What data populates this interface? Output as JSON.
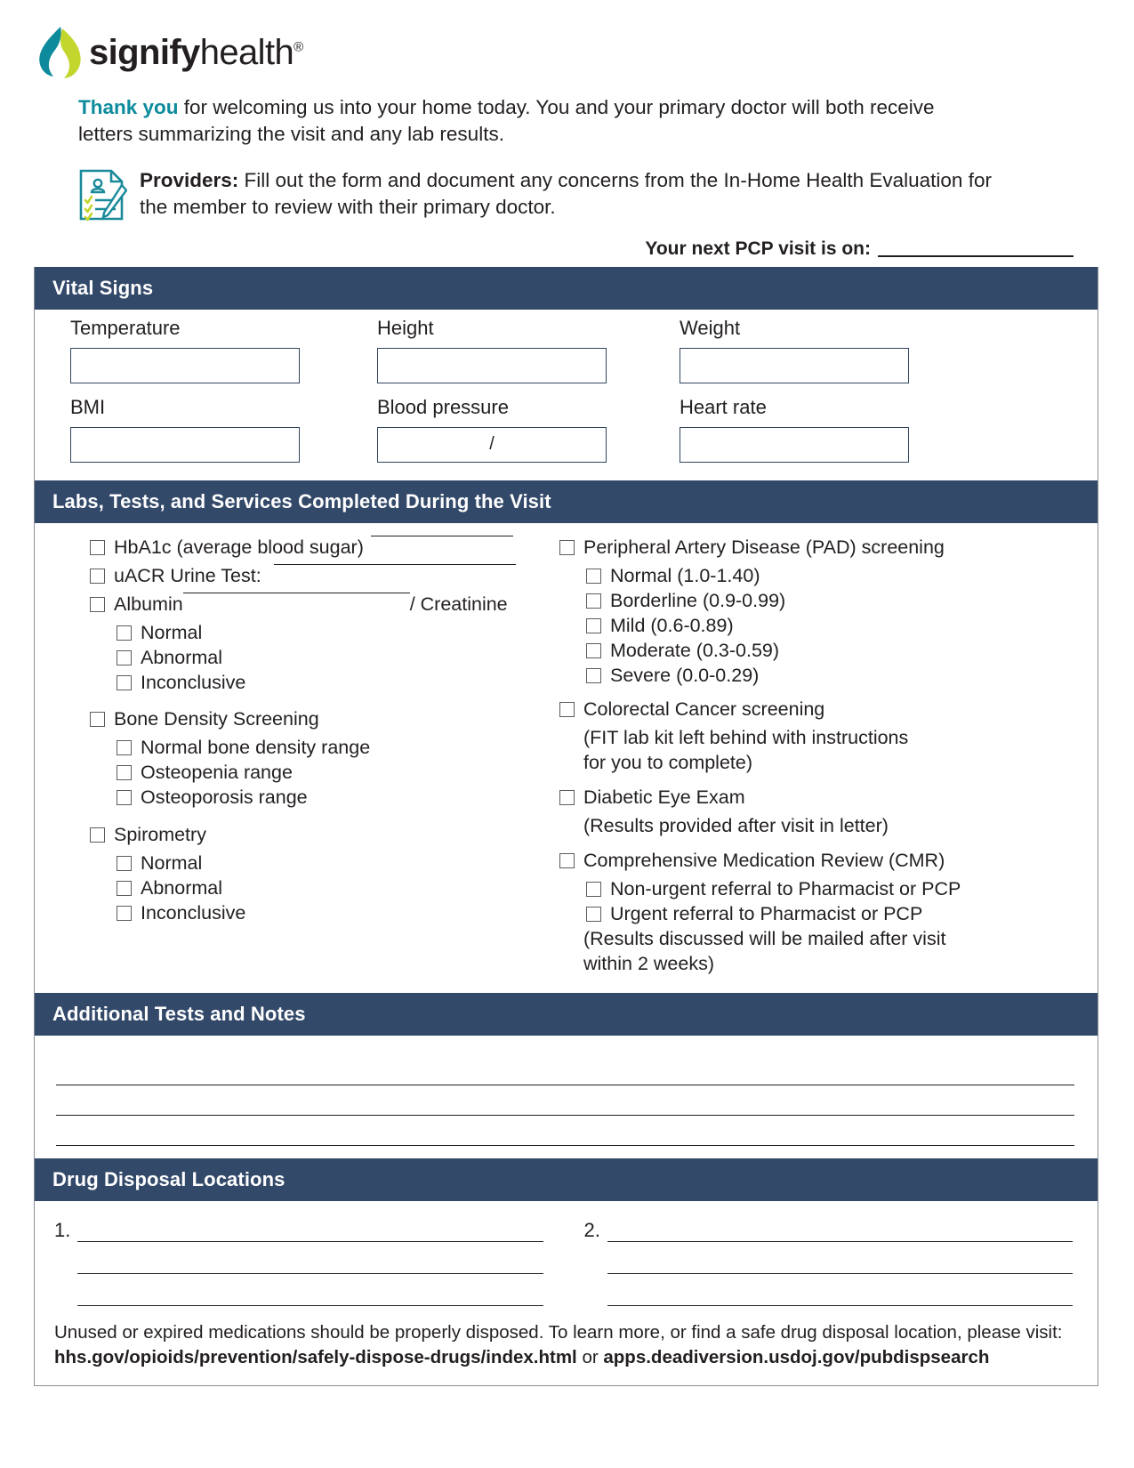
{
  "brand": {
    "logo_text_bold": "signify",
    "logo_text_light": "health",
    "logo_registered": "®",
    "accent_teal": "#0d8b9c",
    "accent_green": "#c3d62e",
    "header_navy": "#33496a"
  },
  "intro": {
    "accent": "Thank you",
    "rest": " for welcoming us into your home today. You and your primary doctor will both receive letters summarizing the visit and any lab results."
  },
  "providers": {
    "label": "Providers:",
    "text": " Fill out the form and document any concerns from the In-Home Health Evaluation for the member to review with their primary doctor."
  },
  "pcp": {
    "label": "Your next PCP visit is on:",
    "value": ""
  },
  "sections": {
    "vitals_title": "Vital Signs",
    "labs_title": "Labs, Tests, and Services Completed During the Visit",
    "notes_title": "Additional Tests and Notes",
    "disposal_title": "Drug Disposal Locations"
  },
  "vitals": [
    {
      "label": "Temperature",
      "value": ""
    },
    {
      "label": "Height",
      "value": ""
    },
    {
      "label": "Weight",
      "value": ""
    },
    {
      "label": "BMI",
      "value": ""
    },
    {
      "label": "Blood pressure",
      "value": "/"
    },
    {
      "label": "Heart rate",
      "value": ""
    }
  ],
  "labs_left": {
    "hba1c": "HbA1c (average blood sugar)",
    "uacr": "uACR Urine Test:",
    "albumin": "Albumin",
    "creatinine": "/ Creatinine",
    "albumin_options": [
      "Normal",
      "Abnormal",
      "Inconclusive"
    ],
    "bone_density": "Bone Density Screening",
    "bone_density_options": [
      "Normal bone density range",
      "Osteopenia range",
      "Osteoporosis range"
    ],
    "spirometry": "Spirometry",
    "spirometry_options": [
      "Normal",
      "Abnormal",
      "Inconclusive"
    ]
  },
  "labs_right": {
    "pad": "Peripheral Artery Disease (PAD) screening",
    "pad_options": [
      "Normal (1.0-1.40)",
      "Borderline (0.9-0.99)",
      "Mild (0.6-0.89)",
      "Moderate (0.3-0.59)",
      "Severe (0.0-0.29)"
    ],
    "colorectal": "Colorectal Cancer screening",
    "colorectal_note1": "(FIT lab kit left behind with instructions",
    "colorectal_note2": " for you to complete)",
    "eye_exam": "Diabetic Eye Exam",
    "eye_exam_note": "(Results provided after visit in letter)",
    "cmr": "Comprehensive Medication Review (CMR)",
    "cmr_options": [
      "Non-urgent referral to Pharmacist or PCP",
      "Urgent referral to Pharmacist or PCP"
    ],
    "cmr_note1": "(Results discussed will be mailed after visit",
    "cmr_note2": "within 2 weeks)"
  },
  "notes": {
    "lines": [
      "",
      "",
      ""
    ]
  },
  "disposal": {
    "item1_number": "1.",
    "item1_value": "",
    "item2_number": "2.",
    "item2_value": "",
    "footer_text": "Unused or expired medications should be properly disposed. To learn more, or find a safe drug disposal location, please visit: ",
    "footer_url1": "hhs.gov/opioids/prevention/safely-dispose-drugs/index.html",
    "footer_or": " or ",
    "footer_url2": "apps.deadiversion.usdoj.gov/pubdispsearch"
  }
}
